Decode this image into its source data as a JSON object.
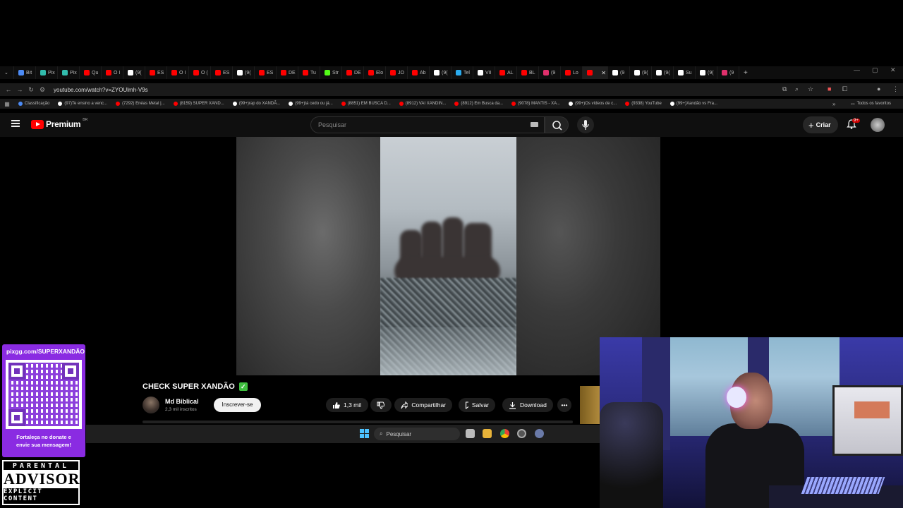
{
  "browser": {
    "tabs": [
      {
        "label": "Bit",
        "color": "#4c8bf5"
      },
      {
        "label": "Pix",
        "color": "#32bcad"
      },
      {
        "label": "Pix",
        "color": "#32bcad"
      },
      {
        "label": "Qu",
        "color": "#ff0000"
      },
      {
        "label": "O I",
        "color": "#ff0000"
      },
      {
        "label": "(9(",
        "color": "#ffffff"
      },
      {
        "label": "ES",
        "color": "#ff0000"
      },
      {
        "label": "O I",
        "color": "#ff0000"
      },
      {
        "label": "O (",
        "color": "#ff0000"
      },
      {
        "label": "ES",
        "color": "#ff0000"
      },
      {
        "label": "(9(",
        "color": "#ffffff"
      },
      {
        "label": "ES",
        "color": "#ff0000"
      },
      {
        "label": "DE",
        "color": "#ff0000"
      },
      {
        "label": "Tu",
        "color": "#ff0000"
      },
      {
        "label": "Str",
        "color": "#53fc18"
      },
      {
        "label": "DE",
        "color": "#ff0000"
      },
      {
        "label": "Elo",
        "color": "#ff0000"
      },
      {
        "label": "JO",
        "color": "#ff0000"
      },
      {
        "label": "Ab",
        "color": "#ff0000"
      },
      {
        "label": "(9(",
        "color": "#ffffff"
      },
      {
        "label": "Tel",
        "color": "#2aabee"
      },
      {
        "label": "VII",
        "color": "#ffffff"
      },
      {
        "label": "AL",
        "color": "#ff0000"
      },
      {
        "label": "BL",
        "color": "#ff0000"
      },
      {
        "label": "(9",
        "color": "#e1306c"
      },
      {
        "label": "Lo",
        "color": "#ff0000"
      },
      {
        "label": "",
        "color": "#ff0000",
        "active": true
      },
      {
        "label": "(9",
        "color": "#ffffff"
      },
      {
        "label": "(9(",
        "color": "#ffffff"
      },
      {
        "label": "(9(",
        "color": "#ffffff"
      },
      {
        "label": "Su",
        "color": "#ffffff"
      },
      {
        "label": "(9(",
        "color": "#ffffff"
      },
      {
        "label": "(9",
        "color": "#e1306c"
      }
    ],
    "new_tab_icon": "plus-icon",
    "url": "youtube.com/watch?v=ZYOUlmh-V9s",
    "bookmarks": [
      {
        "label": "Classificação",
        "color": "#4c8bf5"
      },
      {
        "label": "(97)Te ensino a venc...",
        "color": "#ffffff"
      },
      {
        "label": "(7292) Enéas Metal |...",
        "color": "#ff0000"
      },
      {
        "label": "(8159) SUPER XAND...",
        "color": "#ff0000"
      },
      {
        "label": "(99+)rap do XANDÃ...",
        "color": "#ffffff"
      },
      {
        "label": "(99+)tá cedo ou já...",
        "color": "#ffffff"
      },
      {
        "label": "(8851) EM BUSCA D...",
        "color": "#ff0000"
      },
      {
        "label": "(8912) VAI XANDIN...",
        "color": "#ff0000"
      },
      {
        "label": "(8912) Em Busca da...",
        "color": "#ff0000"
      },
      {
        "label": "(9078) MANTIS - XA...",
        "color": "#ff0000"
      },
      {
        "label": "(99+)Os vídeos de c...",
        "color": "#ffffff"
      },
      {
        "label": "(9338) YouTube",
        "color": "#ff0000"
      },
      {
        "label": "(99+)Xandão vs Fra...",
        "color": "#ffffff"
      }
    ],
    "all_bookmarks": "Todos os favoritos"
  },
  "youtube": {
    "logo_text": "Premium",
    "logo_region": "BR",
    "search_placeholder": "Pesquisar",
    "create_label": "Criar",
    "notification_count": "9+",
    "video": {
      "title": "CHECK SUPER XANDÃO",
      "verified_icon": "✓",
      "channel_name": "Md Biblical",
      "subscribers": "2,3 mil inscritos",
      "subscribe_label": "Inscrever-se",
      "likes": "1,3 mil",
      "share_label": "Compartilhar",
      "save_label": "Salvar",
      "download_label": "Download"
    }
  },
  "taskbar": {
    "search_label": "Pesquisar"
  },
  "overlay": {
    "pix_url": "pixgg.com/SUPERXANDÃO",
    "pix_message_line1": "Fortaleça no donate e",
    "pix_message_line2": "envie sua mensagem!",
    "advisory_line1": "PARENTAL",
    "advisory_line2": "ADVISORY",
    "advisory_line3": "EXPLICIT CONTENT"
  }
}
